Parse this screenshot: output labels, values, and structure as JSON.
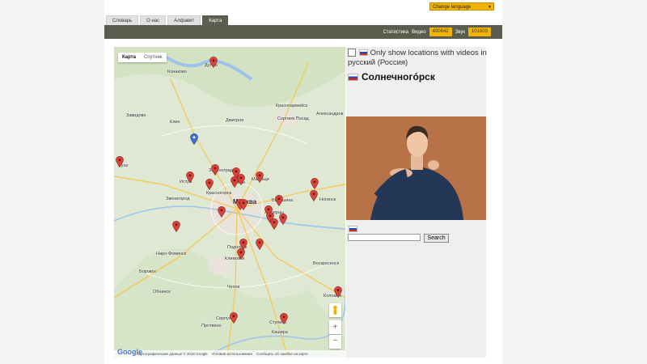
{
  "language_select": {
    "label": "Change language"
  },
  "tabs": [
    {
      "label": "Словарь"
    },
    {
      "label": "О нас"
    },
    {
      "label": "Алфавит"
    },
    {
      "label": "Карта"
    }
  ],
  "stats": {
    "label": "Статистика",
    "video_label": "Видео",
    "video_count": "400642",
    "sound_label": "Звук",
    "sound_count": "101603"
  },
  "map": {
    "type_map": "Карта",
    "type_satellite": "Спутник",
    "footer_data": "Картографические данные © 2018 Google",
    "footer_terms": "Условия использования",
    "footer_report": "Сообщить об ошибке на карте",
    "google_logo": "Google",
    "zoom_in": "+",
    "zoom_out": "−",
    "cities": [
      {
        "name": "Дубна"
      },
      {
        "name": "Конаково"
      },
      {
        "name": "Клин"
      },
      {
        "name": "Дмитров"
      },
      {
        "name": "Сергиев Посад"
      },
      {
        "name": "Александров"
      },
      {
        "name": "Красноармейск"
      },
      {
        "name": "Зеленоград"
      },
      {
        "name": "Химки"
      },
      {
        "name": "Мытищи"
      },
      {
        "name": "Истра"
      },
      {
        "name": "Красногорск"
      },
      {
        "name": "Москва"
      },
      {
        "name": "Балашиха"
      },
      {
        "name": "Люберцы"
      },
      {
        "name": "Звенигород"
      },
      {
        "name": "Наро-Фоминск"
      },
      {
        "name": "Подольск"
      },
      {
        "name": "Климовск"
      },
      {
        "name": "Воскресенск"
      },
      {
        "name": "Боровск"
      },
      {
        "name": "Обнинск"
      },
      {
        "name": "Чехов"
      },
      {
        "name": "Серпухов"
      },
      {
        "name": "Ступино"
      },
      {
        "name": "Протвино"
      },
      {
        "name": "Кашира"
      },
      {
        "name": "Коломна"
      },
      {
        "name": "Руза"
      },
      {
        "name": "Завидово"
      },
      {
        "name": "Ногинск"
      }
    ]
  },
  "panel": {
    "checkbox_label": "Only show locations with videos in русский (Россия)",
    "location_title": "Солнечногóрск"
  },
  "search": {
    "button": "Search",
    "value": ""
  },
  "colors": {
    "accent": "#f2b400",
    "navbar": "#5c5c4e",
    "pin": "#d9443b"
  }
}
